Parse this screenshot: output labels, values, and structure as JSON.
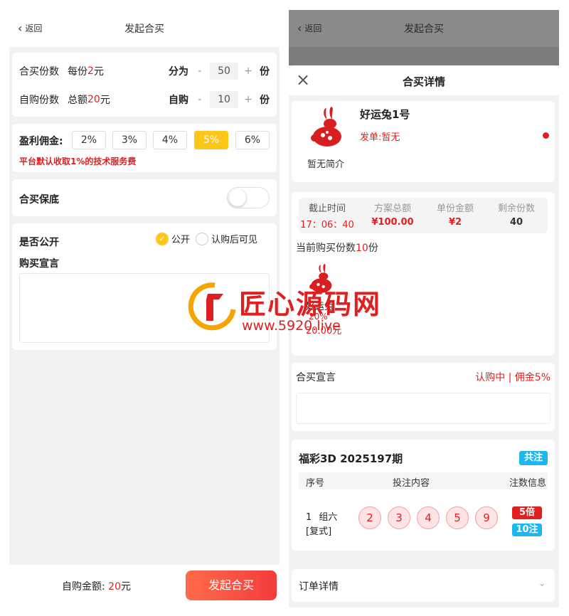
{
  "left": {
    "nav": {
      "back_label": "返回",
      "title": "发起合买"
    },
    "shares": {
      "label": "合买份数",
      "per_prefix": "每份",
      "per_value": "2",
      "per_unit": "元",
      "split_label": "分为",
      "minus": "-",
      "value": "50",
      "plus": "+",
      "unit": "份"
    },
    "self_buy": {
      "label": "自购份数",
      "total_prefix": "总额",
      "total_value": "20",
      "total_unit": "元",
      "buy_label": "自购",
      "minus": "-",
      "value": "10",
      "plus": "+",
      "unit": "份"
    },
    "commission": {
      "label": "盈利佣金:",
      "options": [
        "2%",
        "3%",
        "4%",
        "5%",
        "6%"
      ],
      "selected": "5%",
      "note": "平台默认收取1%的技术服务费"
    },
    "guarantee": {
      "label": "合买保底",
      "enabled": false
    },
    "public": {
      "label": "是否公开",
      "option_public": "公开",
      "option_after": "认购后可见",
      "selected": "公开"
    },
    "declaration": {
      "label": "购买宣言",
      "value": ""
    },
    "footer": {
      "amount_label": "自购金额:",
      "amount_value": "20",
      "amount_unit": "元",
      "submit_label": "发起合买"
    }
  },
  "right": {
    "nav": {
      "back_label": "返回",
      "title": "发起合买"
    },
    "sheet_title": "合买详情",
    "user": {
      "name": "好运兔1号",
      "issuer_label": "发单:暂无",
      "intro": "暂无简介"
    },
    "stats": [
      {
        "label": "截止时间",
        "value": "17：06：40"
      },
      {
        "label": "方案总额",
        "value": "¥100.00"
      },
      {
        "label": "单份金额",
        "value": "¥2"
      },
      {
        "label": "剩余份数",
        "value": "40"
      }
    ],
    "current": {
      "prefix": "当前购买份数",
      "value": "10",
      "unit": "份"
    },
    "buyer": {
      "name": "好运兔",
      "pct": "20%",
      "amount": "20.00元"
    },
    "declaration": {
      "label": "合买宣言",
      "status": "认购中 | 佣金5%"
    },
    "lottery": {
      "title": "福彩3D 2025197期",
      "tag": "共注",
      "headers": [
        "序号",
        "投注内容",
        "注数信息"
      ],
      "row": {
        "index": "1",
        "type": "组六",
        "mode": "[复式]",
        "balls": [
          "2",
          "3",
          "4",
          "5",
          "9"
        ],
        "times": "5倍",
        "count": "10注"
      }
    },
    "order": {
      "label": "订单详情"
    }
  },
  "watermark": {
    "name": "匠心源码网",
    "url": "www.5920.live"
  },
  "colors": {
    "accent_red": "#e02020",
    "selected_yellow": "#ffc61a",
    "badge_blue": "#1fb6ef"
  }
}
